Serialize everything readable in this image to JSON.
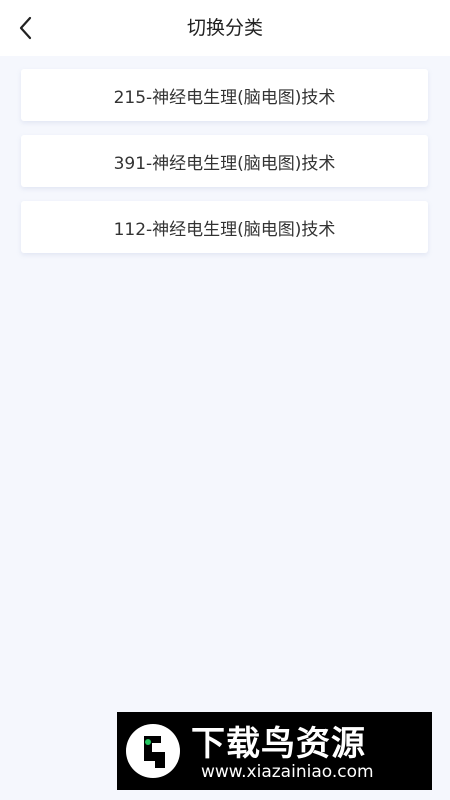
{
  "header": {
    "back_icon": "chevron-left-icon",
    "title": "切换分类"
  },
  "categories": [
    {
      "label": "215-神经电生理(脑电图)技术"
    },
    {
      "label": "391-神经电生理(脑电图)技术"
    },
    {
      "label": "112-神经电生理(脑电图)技术"
    }
  ],
  "watermark": {
    "title": "下载鸟资源",
    "url": "www.xiazainiao.com"
  },
  "colors": {
    "background": "#f5f7fd",
    "card": "#ffffff",
    "text": "#333333",
    "watermark_bg": "#000000",
    "watermark_accent": "#22c55e"
  }
}
